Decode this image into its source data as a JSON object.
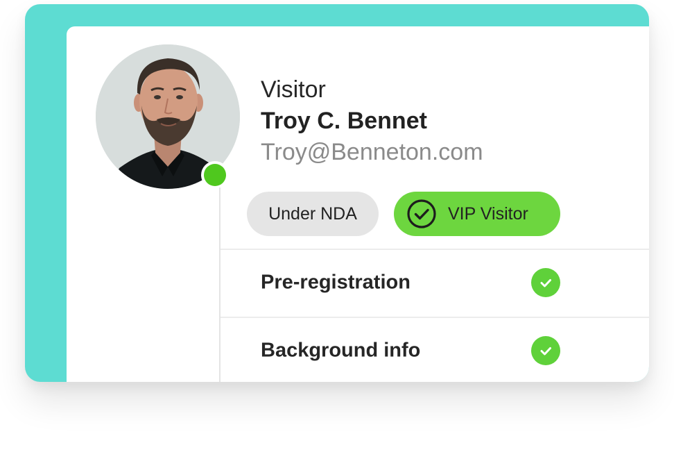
{
  "visitor": {
    "label": "Visitor",
    "name": "Troy C. Bennet",
    "email": "Troy@Benneton.com",
    "status": "online"
  },
  "tags": [
    {
      "label": "Under NDA",
      "icon": ""
    },
    {
      "label": "VIP Visitor",
      "icon": "check-circle-icon"
    }
  ],
  "checklist": [
    {
      "label": "Pre-registration",
      "done": true,
      "icon": "check-icon"
    },
    {
      "label": "Background info",
      "done": true,
      "icon": "check-icon"
    }
  ],
  "colors": {
    "accent": "#5ddcd2",
    "status_green": "#4fc81e",
    "vip_green": "#6dd63f",
    "check_green": "#5fd13a",
    "tag_gray": "#e5e5e5"
  }
}
